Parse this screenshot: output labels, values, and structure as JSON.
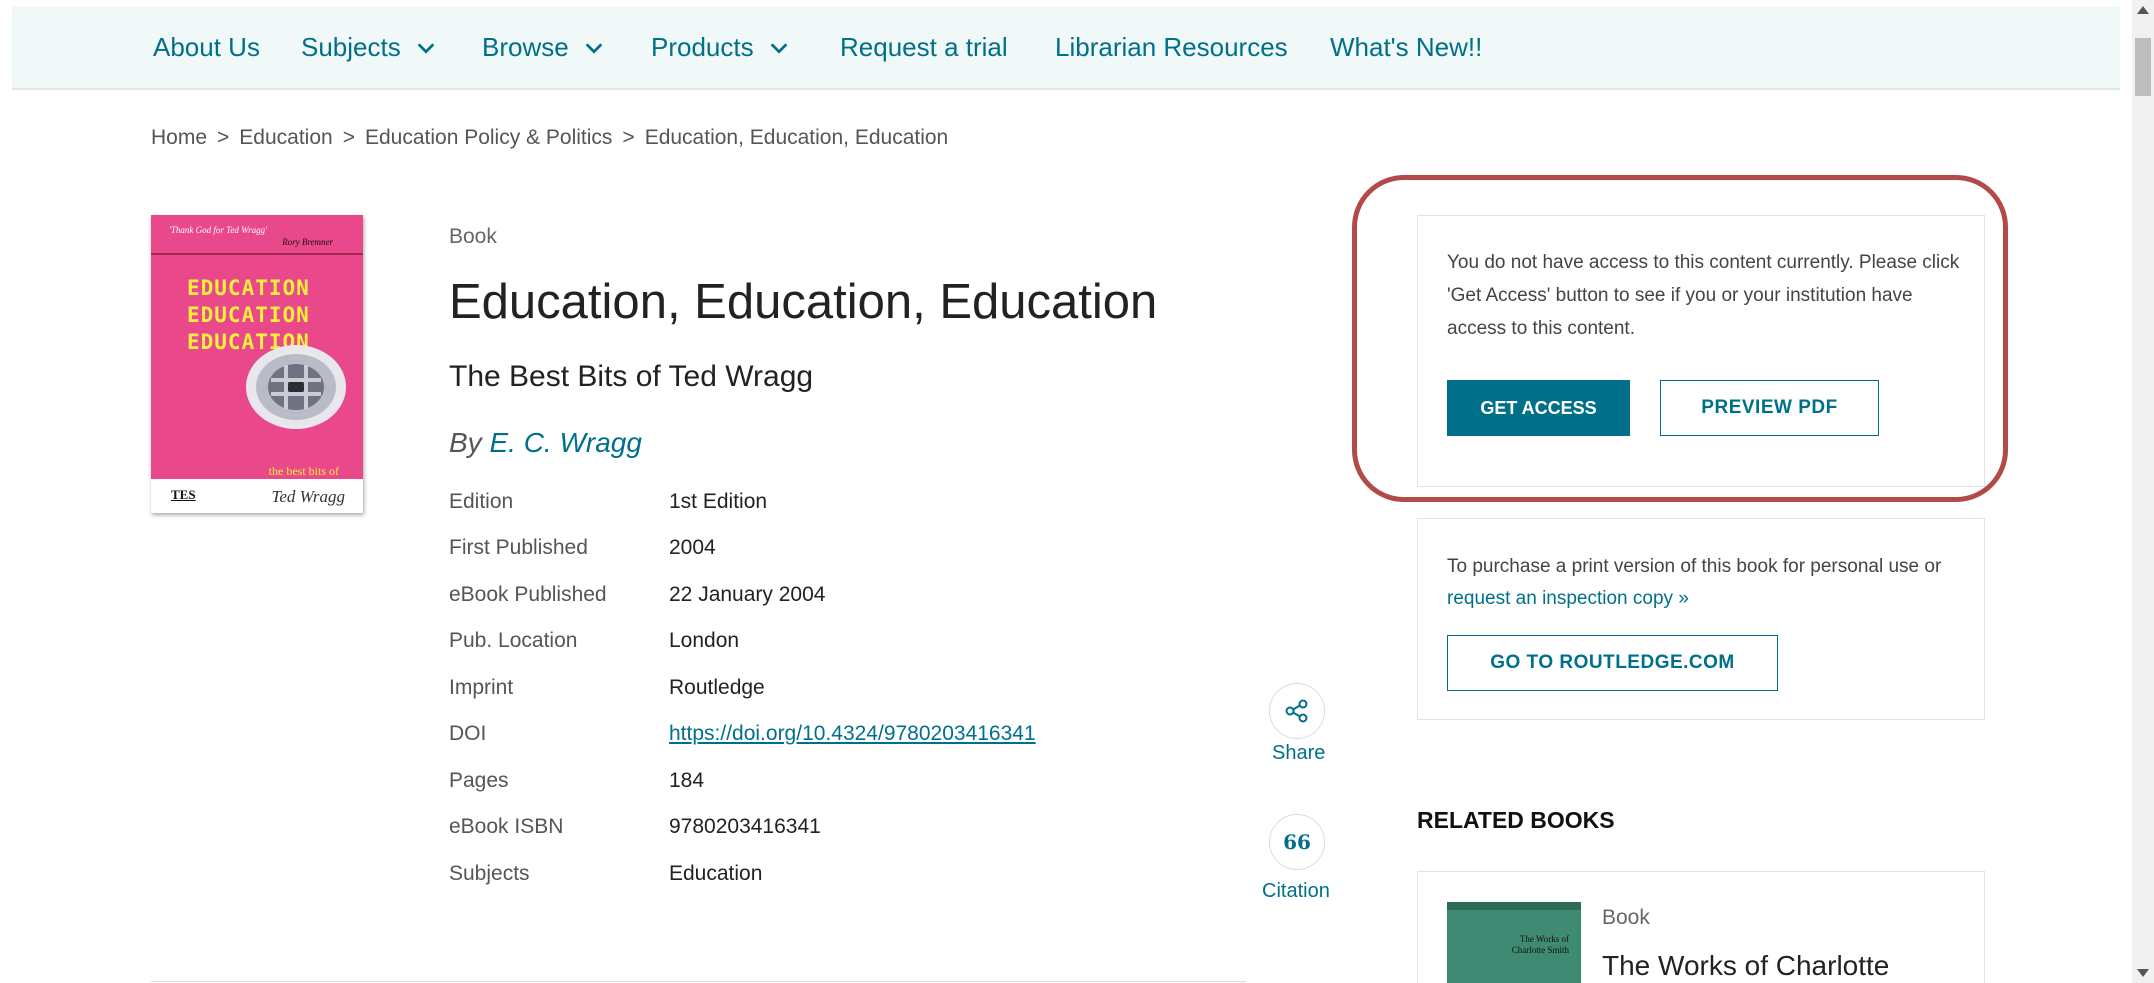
{
  "nav": {
    "items": [
      {
        "label": "About Us",
        "dropdown": false
      },
      {
        "label": "Subjects",
        "dropdown": true
      },
      {
        "label": "Browse",
        "dropdown": true
      },
      {
        "label": "Products",
        "dropdown": true
      },
      {
        "label": "Request a trial",
        "dropdown": false
      },
      {
        "label": "Librarian Resources",
        "dropdown": false
      },
      {
        "label": "What's New!!",
        "dropdown": false
      }
    ]
  },
  "breadcrumb": [
    "Home",
    "Education",
    "Education Policy & Politics",
    "Education, Education, Education"
  ],
  "cover": {
    "quote": "'Thank God for Ted Wragg'",
    "quote_author": "Rory Bremner",
    "title_lines": "EDUCATION\nEDUCATION\nEDUCATION",
    "tagline": "the best bits of",
    "publisher_mark": "TES",
    "signature": "Ted Wragg"
  },
  "book": {
    "type": "Book",
    "title": "Education, Education, Education",
    "subtitle": "The Best Bits of Ted Wragg",
    "by": "By",
    "author": "E. C. Wragg",
    "details": [
      {
        "label": "Edition",
        "value": "1st Edition"
      },
      {
        "label": "First Published",
        "value": "2004"
      },
      {
        "label": "eBook Published",
        "value": "22 January 2004"
      },
      {
        "label": "Pub. Location",
        "value": "London"
      },
      {
        "label": "Imprint",
        "value": "Routledge"
      },
      {
        "label": "DOI",
        "value": "https://doi.org/10.4324/9780203416341"
      },
      {
        "label": "Pages",
        "value": "184"
      },
      {
        "label": "eBook ISBN",
        "value": "9780203416341"
      },
      {
        "label": "Subjects",
        "value": "Education"
      }
    ]
  },
  "actions": {
    "share": "Share",
    "citation": "Citation",
    "citation_icon": "66"
  },
  "access": {
    "message": "You do not have access to this content currently. Please click 'Get Access' button to see if you or your institution have access to this content.",
    "get_access": "GET ACCESS",
    "preview_pdf": "PREVIEW PDF"
  },
  "purchase": {
    "text_before": "To purchase a print version of this book for personal use or ",
    "link": "request an inspection copy",
    "arrow": "»",
    "button": "GO TO ROUTLEDGE.COM"
  },
  "related": {
    "heading": "RELATED BOOKS",
    "cover_title": "The Works of\nCharlotte Smith",
    "type": "Book",
    "title": "The Works of Charlotte"
  },
  "colors": {
    "accent": "#00708a",
    "highlight": "#b34a4a",
    "nav_bg": "#f1f8f8"
  }
}
